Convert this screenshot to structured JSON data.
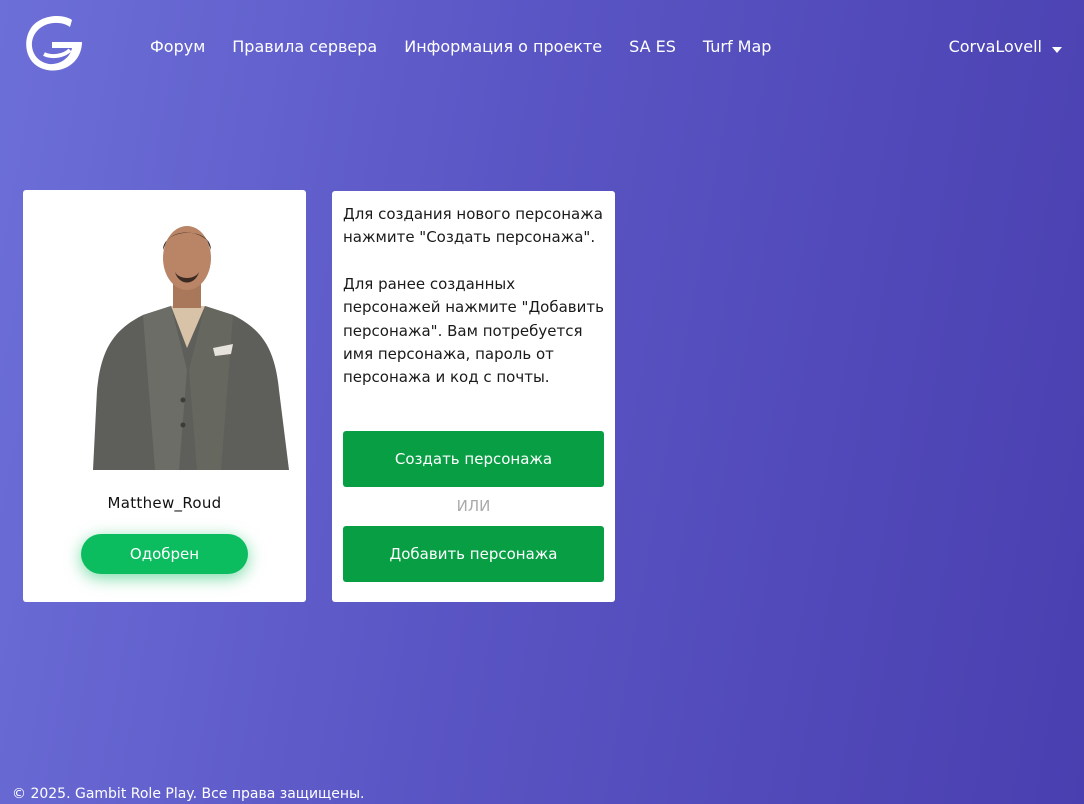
{
  "header": {
    "logo_icon": "gambit-logo-icon",
    "nav": [
      {
        "label": "Форум"
      },
      {
        "label": "Правила сервера"
      },
      {
        "label": "Информация о проекте"
      },
      {
        "label": "SA ES"
      },
      {
        "label": "Turf Map"
      }
    ],
    "user": {
      "name": "CorvaLovell",
      "dropdown_icon": "caret-down-icon"
    }
  },
  "character": {
    "name": "Matthew_Roud",
    "status": "Одобрен",
    "status_color": "#0bbd5f"
  },
  "info": {
    "paragraph_1": "Для создания нового персонажа нажмите \"Создать персонажа\".",
    "paragraph_2": "Для ранее созданных персонажей нажмите \"Добавить персонажа\". Вам потребуется имя персонажа, пароль от персонажа и код с почты.",
    "create_label": "Создать персонажа",
    "or_label": "ИЛИ",
    "add_label": "Добавить персонажа",
    "button_color": "#079e44"
  },
  "footer": {
    "copyright": "© 2025. Gambit Role Play. Все права защищены."
  }
}
